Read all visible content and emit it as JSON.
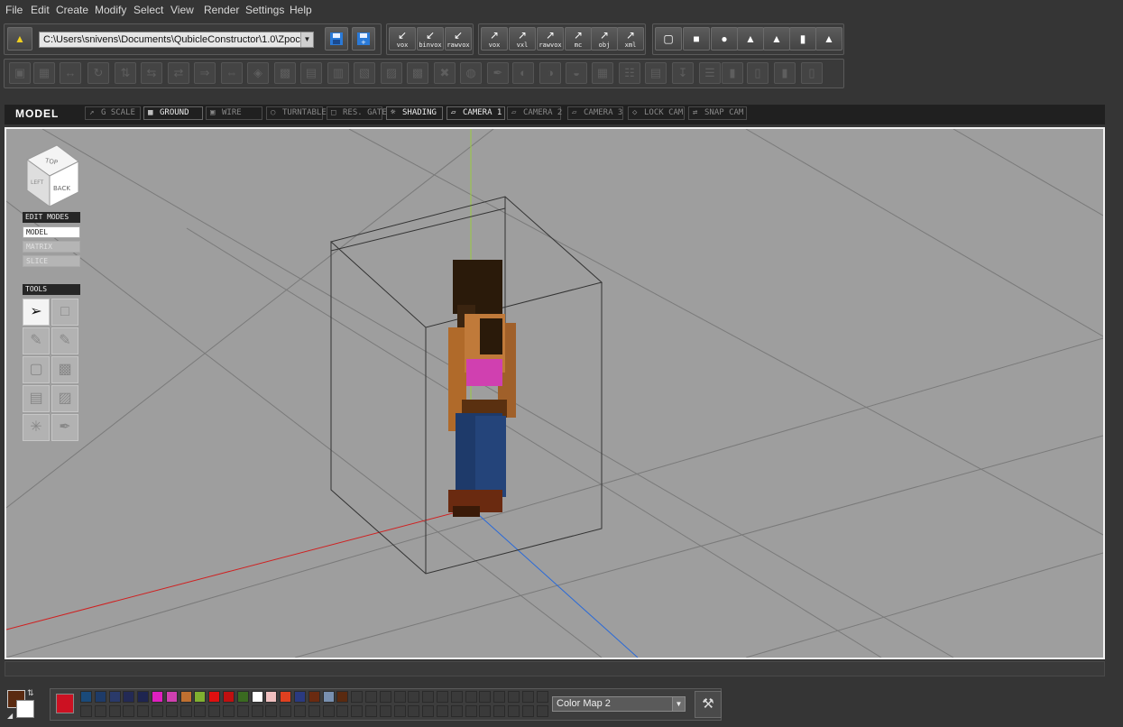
{
  "menu": [
    "File",
    "Edit",
    "Create",
    "Modify",
    "Select",
    "View",
    "Render",
    "Settings",
    "Help"
  ],
  "toolbar": {
    "path_value": "C:\\Users\\snivens\\Documents\\QubicleConstructor\\1.0\\Zpoc",
    "import_buttons": [
      "vox",
      "binvox",
      "rawvox"
    ],
    "export_buttons": [
      "vox",
      "vxl",
      "rawvox",
      "mc",
      "obj",
      "xml"
    ]
  },
  "viewbar": {
    "title": "MODEL",
    "tabs": [
      {
        "label": "G SCALE",
        "icon": "scale-icon",
        "active": false
      },
      {
        "label": "GROUND",
        "icon": "grid-icon",
        "active": true
      },
      {
        "label": "WIRE",
        "icon": "wire-icon",
        "active": false
      },
      {
        "label": "TURNTABLE",
        "icon": "turntable-icon",
        "active": false
      },
      {
        "label": "RES. GATE",
        "icon": "res-gate-icon",
        "active": false
      },
      {
        "label": "SHADING",
        "icon": "sun-icon",
        "active": true
      },
      {
        "label": "CAMERA 1",
        "icon": "camera-icon",
        "active": true
      },
      {
        "label": "CAMERA 2",
        "icon": "camera-icon",
        "active": false
      },
      {
        "label": "CAMERA 3",
        "icon": "camera-icon",
        "active": false
      },
      {
        "label": "LOCK CAM",
        "icon": "lock-icon",
        "active": false
      },
      {
        "label": "SNAP CAM",
        "icon": "snap-icon",
        "active": false
      }
    ]
  },
  "viewcube": {
    "top": "TOP",
    "back": "BACK",
    "left": "LEFT"
  },
  "edit_modes": {
    "title": "EDIT MODES",
    "items": [
      {
        "label": "MODEL",
        "active": true
      },
      {
        "label": "MATRIX",
        "active": false
      },
      {
        "label": "SLICE",
        "active": false
      }
    ]
  },
  "tools": {
    "title": "TOOLS"
  },
  "palette": {
    "primary_color": "#5a2a10",
    "secondary_color": "#ffffff",
    "active_swatch": "#cc1122",
    "swatches": [
      "#1a4a7a",
      "#1e3b68",
      "#2a3a6a",
      "#232a55",
      "#1e2550",
      "#e020c0",
      "#d040b0",
      "#c07030",
      "#80b030",
      "#e01010",
      "#c01010",
      "#3a6a20",
      "#ffffff",
      "#f0c0c0",
      "#e04020",
      "#2a3a80",
      "#6a2a10",
      "#7890b0",
      "#5a2a10"
    ],
    "color_map": "Color Map 2"
  }
}
